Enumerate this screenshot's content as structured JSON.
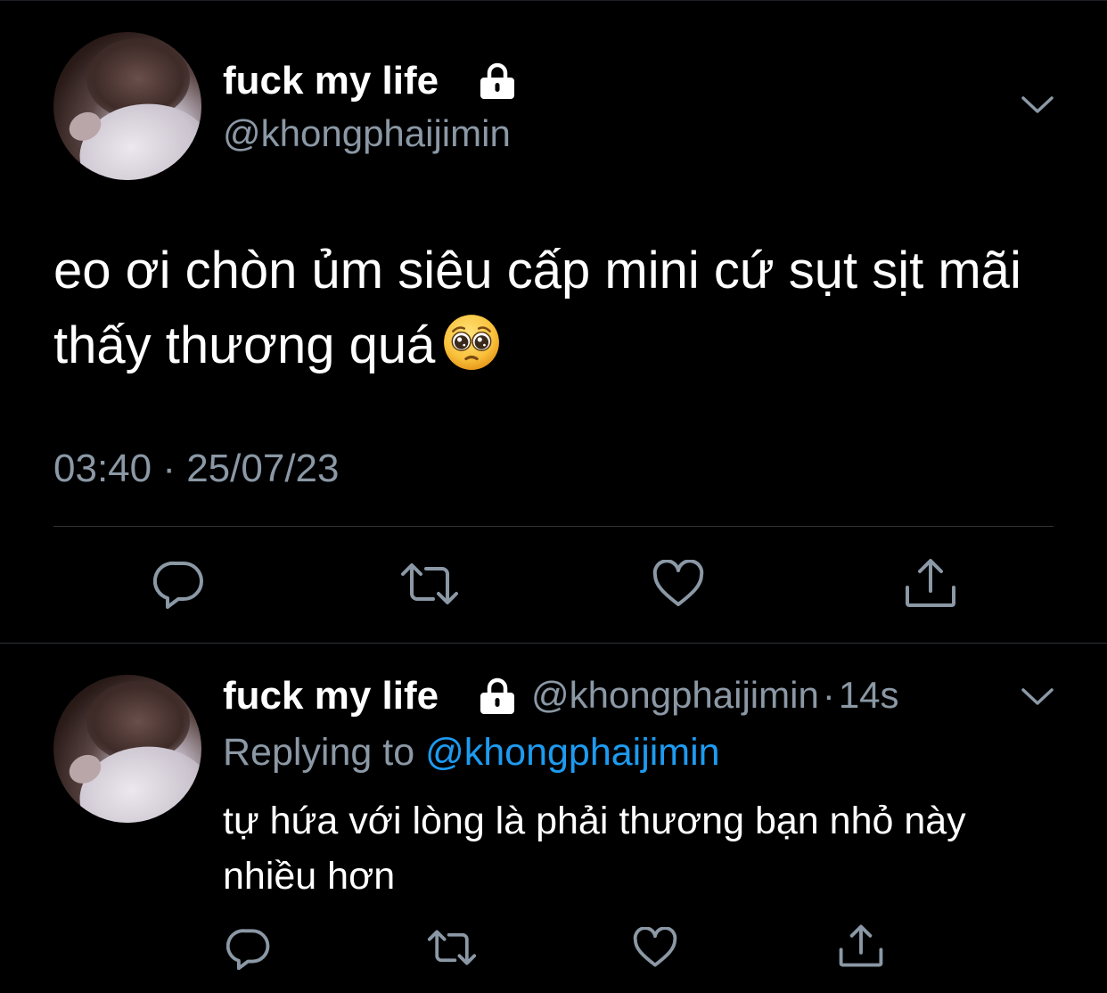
{
  "main_tweet": {
    "display_name": "fuck my life",
    "handle": "@khongphaijimin",
    "text": "eo ơi chòn ủm siêu cấp mini cứ sụt sịt mãi thấy thương quá",
    "emoji": "pleading-face",
    "timestamp": "03:40 · 25/07/23",
    "protected": true
  },
  "reply_tweet": {
    "display_name": "fuck my life",
    "handle": "@khongphaijimin",
    "separator": "·",
    "age": "14s",
    "replying_prefix": "Replying to",
    "replying_to": "@khongphaijimin",
    "text": "tự hứa với lòng là phải thương bạn nhỏ này nhiều hơn",
    "protected": true
  },
  "actions": [
    "reply-icon",
    "retweet-icon",
    "like-icon",
    "share-icon"
  ],
  "colors": {
    "background": "#000000",
    "text": "#ffffff",
    "secondary": "#8b98a5",
    "link": "#1d9bf0",
    "divider": "#2f3336"
  }
}
